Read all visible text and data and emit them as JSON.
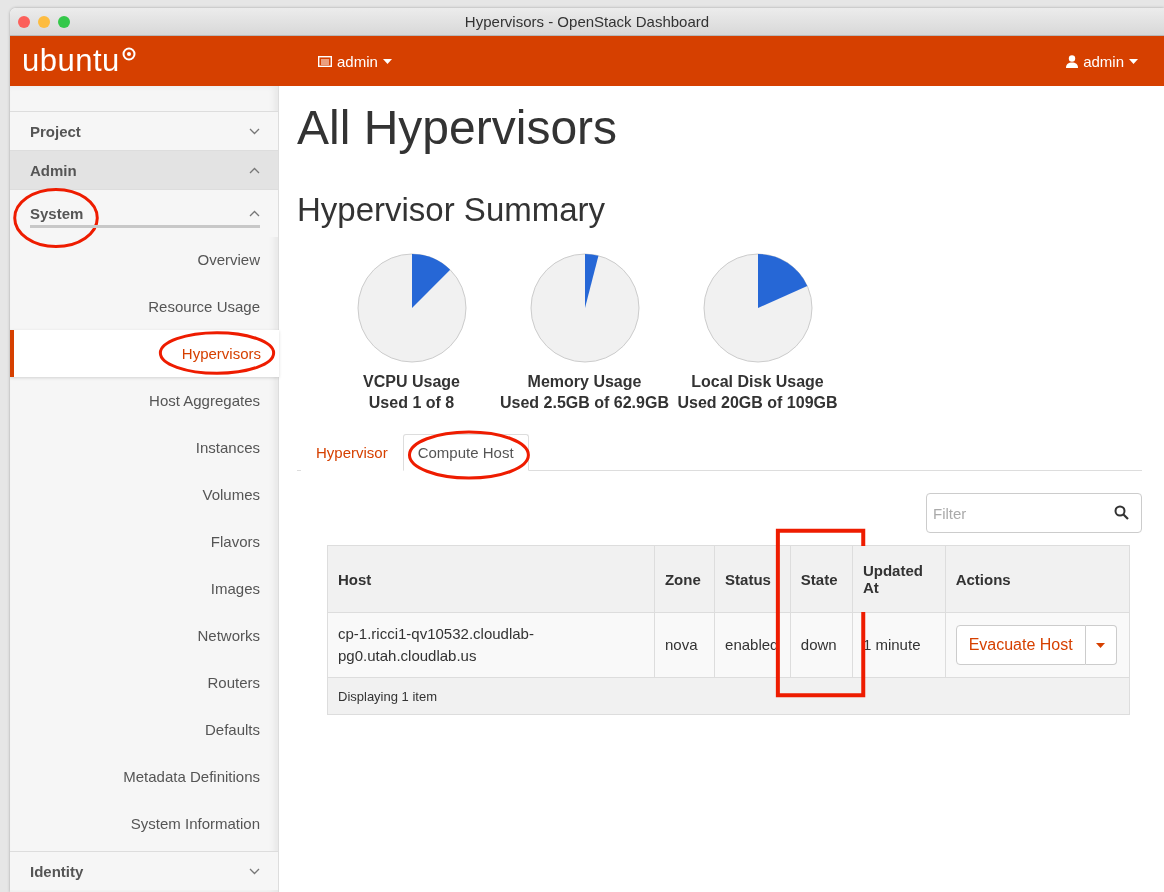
{
  "window": {
    "title": "Hypervisors - OpenStack Dashboard"
  },
  "header": {
    "logo": "ubuntu",
    "project_menu": "admin",
    "user_menu": "admin"
  },
  "sidebar": {
    "items": [
      {
        "label": "Project",
        "expanded": false,
        "circled": false
      },
      {
        "label": "Admin",
        "expanded": true,
        "circled": false,
        "children": [
          {
            "label": "System",
            "expanded": true,
            "circled": true,
            "children": [
              {
                "label": "Overview",
                "selected": false,
                "circled": false
              },
              {
                "label": "Resource Usage",
                "selected": false,
                "circled": false
              },
              {
                "label": "Hypervisors",
                "selected": true,
                "circled": true
              },
              {
                "label": "Host Aggregates",
                "selected": false,
                "circled": false
              },
              {
                "label": "Instances",
                "selected": false,
                "circled": false
              },
              {
                "label": "Volumes",
                "selected": false,
                "circled": false
              },
              {
                "label": "Flavors",
                "selected": false,
                "circled": false
              },
              {
                "label": "Images",
                "selected": false,
                "circled": false
              },
              {
                "label": "Networks",
                "selected": false,
                "circled": false
              },
              {
                "label": "Routers",
                "selected": false,
                "circled": false
              },
              {
                "label": "Defaults",
                "selected": false,
                "circled": false
              },
              {
                "label": "Metadata Definitions",
                "selected": false,
                "circled": false
              },
              {
                "label": "System Information",
                "selected": false,
                "circled": false
              }
            ]
          }
        ]
      },
      {
        "label": "Identity",
        "expanded": false,
        "circled": false
      }
    ]
  },
  "page_title": "All Hypervisors",
  "summary": {
    "title": "Hypervisor Summary",
    "charts": [
      {
        "title": "VCPU Usage",
        "caption": "Used 1 of 8"
      },
      {
        "title": "Memory Usage",
        "caption": "Used 2.5GB of 62.9GB"
      },
      {
        "title": "Local Disk Usage",
        "caption": "Used 20GB of 109GB"
      }
    ]
  },
  "tabs": [
    {
      "label": "Hypervisor",
      "selected": false,
      "circled": false
    },
    {
      "label": "Compute Host",
      "selected": true,
      "circled": true
    }
  ],
  "filter": {
    "placeholder": "Filter"
  },
  "table": {
    "columns": [
      {
        "label": "Host",
        "boxed": false
      },
      {
        "label": "Zone",
        "boxed": false
      },
      {
        "label": "Status",
        "boxed": false
      },
      {
        "label": "State",
        "boxed": true
      },
      {
        "label": "Updated At",
        "boxed": false
      },
      {
        "label": "Actions",
        "boxed": false
      }
    ],
    "rows": [
      {
        "cells": [
          "cp-1.ricci1-qv10532.cloudlab-pg0.utah.cloudlab.us",
          "nova",
          "enabled",
          "down",
          "1 minute"
        ],
        "action": "Evacuate Host"
      }
    ],
    "footer": "Displaying 1 item"
  }
}
